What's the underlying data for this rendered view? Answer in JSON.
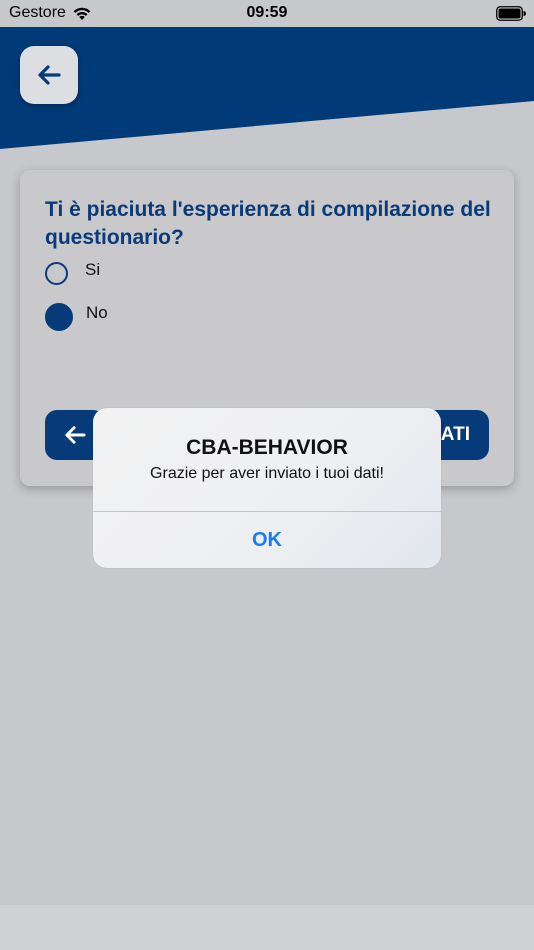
{
  "status_bar": {
    "carrier": "Gestore",
    "time": "09:59",
    "wifi_icon": "wifi-icon",
    "battery_icon": "battery-icon"
  },
  "header": {
    "back_icon": "arrow-left-icon",
    "brand_color": "#003a78"
  },
  "card": {
    "question": "Ti è piaciuta l'esperienza di compilazione del questionario?",
    "options": [
      {
        "label": "Si",
        "selected": false
      },
      {
        "label": "No",
        "selected": true
      }
    ],
    "back_icon": "arrow-left-icon",
    "send_label_visible": "ATI"
  },
  "alert": {
    "title": "CBA-BEHAVIOR",
    "message": "Grazie per aver inviato i tuoi dati!",
    "ok_label": "OK",
    "ok_color": "#1b7bf0"
  }
}
